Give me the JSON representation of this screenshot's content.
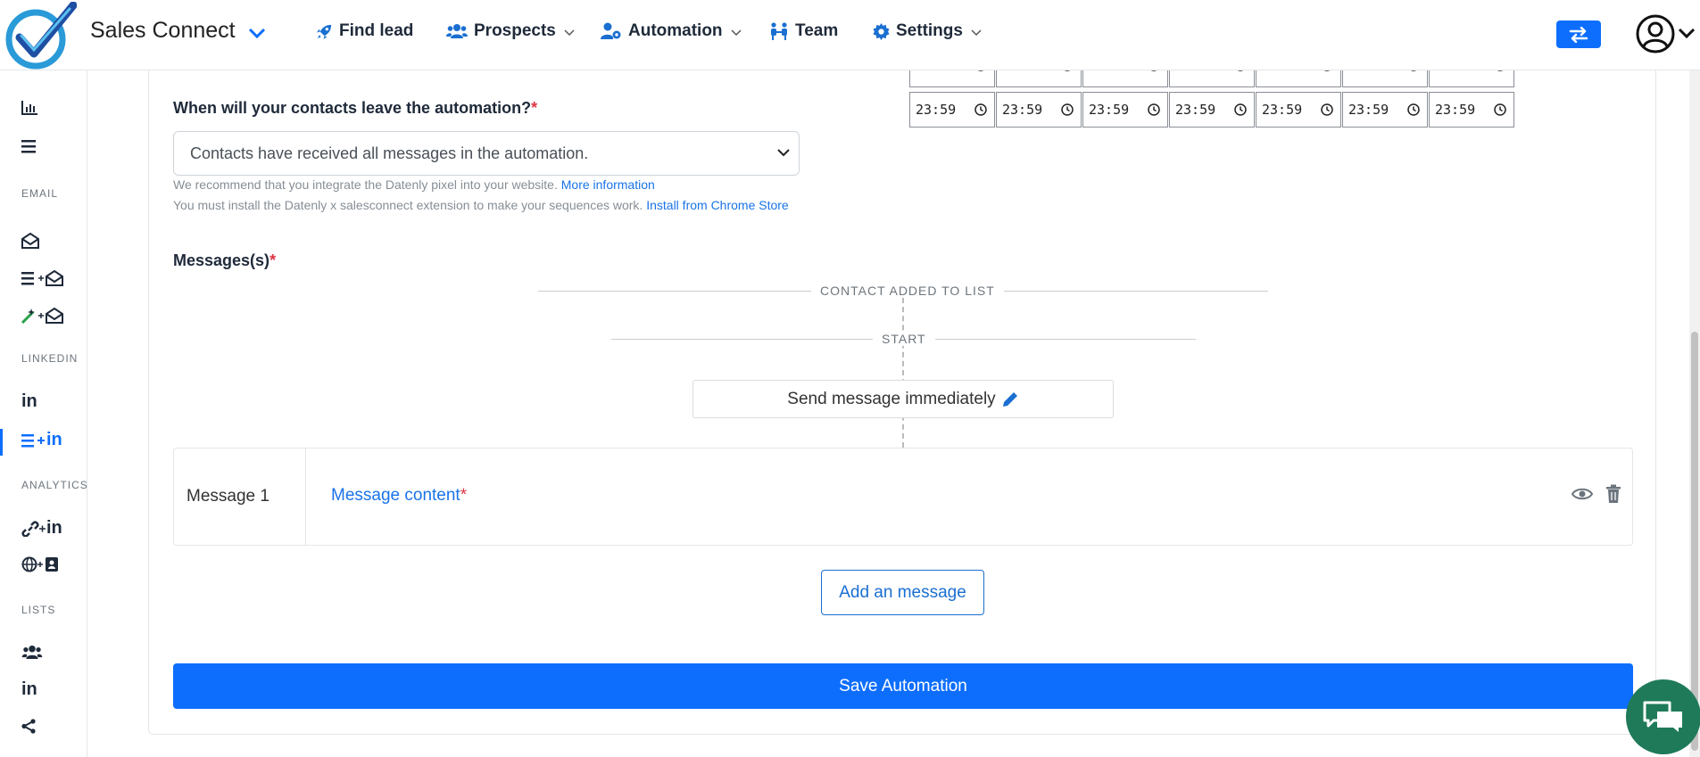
{
  "brand": {
    "name": "Sales Connect",
    "color": "#0d6efd"
  },
  "nav": {
    "find_lead": "Find lead",
    "prospects": "Prospects",
    "automation": "Automation",
    "team": "Team",
    "settings": "Settings"
  },
  "sidebar": {
    "sections": {
      "email": "EMAIL",
      "linkedin": "LINKEDIN",
      "analytics": "ANALYTICS",
      "lists": "LISTS"
    },
    "items": {
      "analytics_chart": "chart-icon",
      "list": "list-icon",
      "email_inbox": "envelope-open-icon",
      "email_sequence": "list-plus-envelope-icon",
      "email_magic": "magic-plus-envelope-icon",
      "linkedin": "in",
      "linkedin_sequence": "in",
      "analytics_link": "in",
      "analytics_web": "globe-plus-contact-icon",
      "lists_people": "users-icon",
      "lists_linkedin": "in",
      "lists_share": "share-icon"
    }
  },
  "form": {
    "leave_label": "When will your contacts leave the automation?",
    "required_mark": "*",
    "leave_select_value": "Contacts have received all messages in the automation.",
    "help1_text": "We recommend that you integrate the Datenly pixel into your website.",
    "help1_link": "More information",
    "help2_text": "You must install the Datenly x salesconnect extension to make your sequences work.",
    "help2_link": "Install from Chrome Store",
    "times": [
      "23:59",
      "23:59",
      "23:59",
      "23:59",
      "23:59",
      "23:59",
      "23:59"
    ]
  },
  "messages": {
    "label": "Messages(s)",
    "flow_start_top": "CONTACT ADDED TO LIST",
    "flow_start": "START",
    "send_text": "Send message immediately",
    "rows": [
      {
        "name": "Message 1",
        "content_label": "Message content"
      }
    ],
    "add_button": "Add an message",
    "save_button": "Save Automation"
  }
}
